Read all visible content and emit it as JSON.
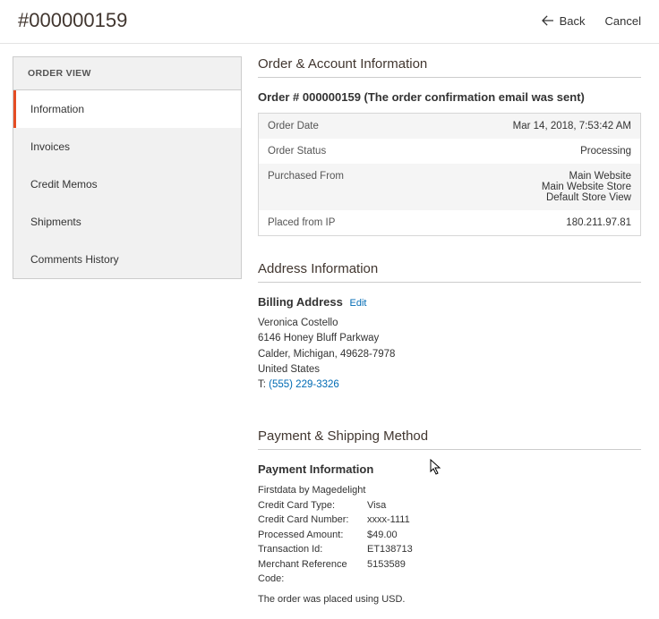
{
  "header": {
    "title": "#000000159",
    "back": "Back",
    "cancel": "Cancel"
  },
  "sidebar": {
    "title": "ORDER VIEW",
    "items": [
      {
        "label": "Information",
        "active": true
      },
      {
        "label": "Invoices",
        "active": false
      },
      {
        "label": "Credit Memos",
        "active": false
      },
      {
        "label": "Shipments",
        "active": false
      },
      {
        "label": "Comments History",
        "active": false
      }
    ]
  },
  "order_account": {
    "section_title": "Order & Account Information",
    "heading": "Order # 000000159 (The order confirmation email was sent)",
    "rows": {
      "order_date": {
        "label": "Order Date",
        "value": "Mar 14, 2018, 7:53:42 AM"
      },
      "order_status": {
        "label": "Order Status",
        "value": "Processing"
      },
      "purchased_from": {
        "label": "Purchased From",
        "value_lines": [
          "Main Website",
          "Main Website Store",
          "Default Store View"
        ]
      },
      "placed_from_ip": {
        "label": "Placed from IP",
        "value": "180.211.97.81"
      }
    }
  },
  "address": {
    "section_title": "Address Information",
    "billing_heading": "Billing Address",
    "edit_label": "Edit",
    "name": "Veronica Costello",
    "street": "6146 Honey Bluff Parkway",
    "city": "Calder, Michigan, 49628-7978",
    "country": "United States",
    "phone_prefix": "T: ",
    "phone": "(555) 229-3326"
  },
  "payment": {
    "section_title": "Payment & Shipping Method",
    "heading": "Payment Information",
    "method": "Firstdata by Magedelight",
    "cc_type": {
      "label": "Credit Card Type:",
      "value": "Visa"
    },
    "cc_number": {
      "label": "Credit Card Number:",
      "value": "xxxx-1111"
    },
    "processed_amount": {
      "label": "Processed Amount:",
      "value": "$49.00"
    },
    "transaction_id": {
      "label": "Transaction Id:",
      "value": "ET138713"
    },
    "merchant_ref": {
      "label": "Merchant Reference Code:",
      "value": "5153589"
    },
    "currency_note": "The order was placed using USD."
  }
}
